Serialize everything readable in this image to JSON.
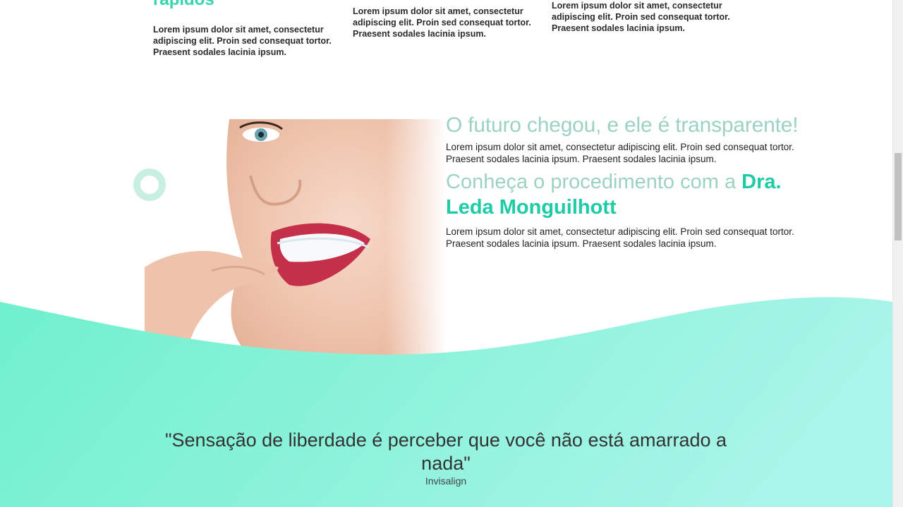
{
  "features": [
    {
      "title": "rápidos",
      "text": "Lorem ipsum dolor sit amet, consectetur adipiscing elit. Proin sed consequat tortor. Praesent sodales lacinia ipsum."
    },
    {
      "text": "Lorem ipsum dolor sit amet, consectetur adipiscing elit. Proin sed consequat tortor. Praesent sodales lacinia ipsum."
    },
    {
      "text": "Lorem ipsum dolor sit amet, consectetur adipiscing elit. Proin sed consequat tortor. Praesent sodales lacinia ipsum."
    }
  ],
  "section": {
    "headline": "O futuro chegou, e ele é transparente!",
    "paragraph1": "Lorem ipsum dolor sit amet, consectetur adipiscing elit. Proin sed consequat tortor. Praesent sodales lacinia ipsum. Praesent sodales lacinia ipsum.",
    "headline2_prefix": "Conheça o procedimento com a ",
    "headline2_highlight": "Dra. Leda Monguilhott",
    "paragraph2": "Lorem ipsum dolor sit amet, consectetur adipiscing elit. Proin sed consequat tortor. Praesent sodales lacinia ipsum. Praesent sodales lacinia ipsum.",
    "image_icon": "woman-with-clear-aligner-photo"
  },
  "quote": {
    "text": "\"Sensação de liberdade é perceber que você não está amarrado a nada\"",
    "author": "Invisalign"
  },
  "colors": {
    "accent": "#1dcca4",
    "headline_muted": "#9cd2c4",
    "wave_start": "#6ff0cc",
    "wave_end": "#a9f5e9"
  }
}
